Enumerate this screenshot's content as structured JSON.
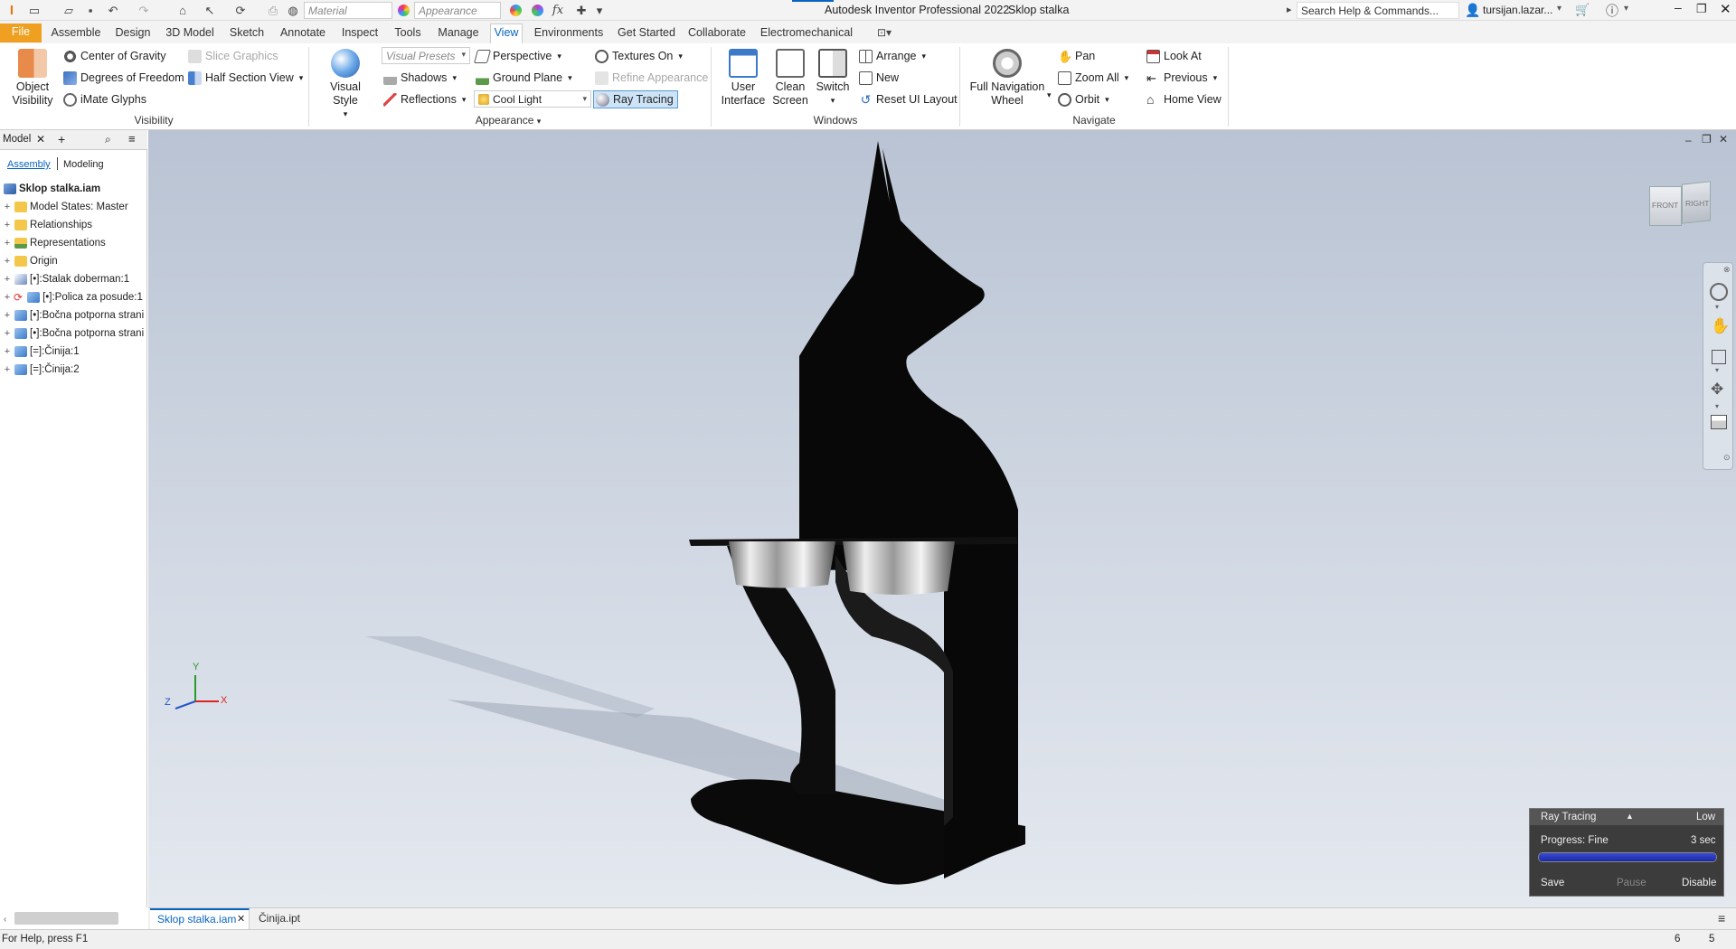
{
  "titlebar": {
    "app_title": "Autodesk Inventor Professional 2022",
    "document": "Sklop stalka",
    "search_placeholder": "Search Help & Commands...",
    "user": "tursijan.lazar...",
    "material_combo": "Material",
    "appearance_combo": "Appearance",
    "fx": "fx"
  },
  "tabs": [
    "File",
    "Assemble",
    "Design",
    "3D Model",
    "Sketch",
    "Annotate",
    "Inspect",
    "Tools",
    "Manage",
    "View",
    "Environments",
    "Get Started",
    "Collaborate",
    "Electromechanical"
  ],
  "ribbon": {
    "visibility": {
      "object_visibility": "Object Visibility",
      "center_of_gravity": "Center of Gravity",
      "degrees_of_freedom": "Degrees of Freedom",
      "imate_glyphs": "iMate Glyphs",
      "slice_graphics": "Slice Graphics",
      "half_section_view": "Half Section View",
      "group_label": "Visibility"
    },
    "appearance": {
      "visual_style": "Visual Style",
      "visual_presets": "Visual Presets",
      "shadows": "Shadows",
      "reflections": "Reflections",
      "perspective": "Perspective",
      "ground_plane": "Ground Plane",
      "lighting": "Cool Light",
      "textures_on": "Textures On",
      "refine_appearance": "Refine Appearance",
      "ray_tracing": "Ray Tracing",
      "group_label": "Appearance"
    },
    "windows": {
      "user_interface": "User Interface",
      "clean_screen": "Clean Screen",
      "switch": "Switch",
      "arrange": "Arrange",
      "new": "New",
      "reset_ui_layout": "Reset UI Layout",
      "group_label": "Windows"
    },
    "navigate": {
      "full_nav_wheel": "Full Navigation Wheel",
      "pan": "Pan",
      "zoom_all": "Zoom All",
      "orbit": "Orbit",
      "look_at": "Look At",
      "previous": "Previous",
      "home_view": "Home View",
      "group_label": "Navigate"
    }
  },
  "browser": {
    "tab": "Model",
    "assembly": "Assembly",
    "modeling": "Modeling",
    "root": "Sklop stalka.iam",
    "items": [
      "Model States: Master",
      "Relationships",
      "Representations",
      "Origin",
      "[•]:Stalak doberman:1",
      "[•]:Polica za posude:1",
      "[•]:Bočna potporna strani",
      "[•]:Bočna potporna strani",
      "[=]:Činija:1",
      "[=]:Činija:2"
    ]
  },
  "viewcube": {
    "front": "FRONT",
    "right": "RIGHT"
  },
  "axes": {
    "x": "X",
    "y": "Y",
    "z": "Z"
  },
  "ray_tracing_panel": {
    "title": "Ray Tracing",
    "quality": "Low",
    "progress_label": "Progress: Fine",
    "time": "3 sec",
    "progress": 1.0,
    "save": "Save",
    "pause": "Pause",
    "disable": "Disable"
  },
  "doc_tabs": [
    "Sklop stalka.iam",
    "Činija.ipt"
  ],
  "status": {
    "help": "For Help, press F1",
    "count1": "6",
    "count2": "5"
  }
}
